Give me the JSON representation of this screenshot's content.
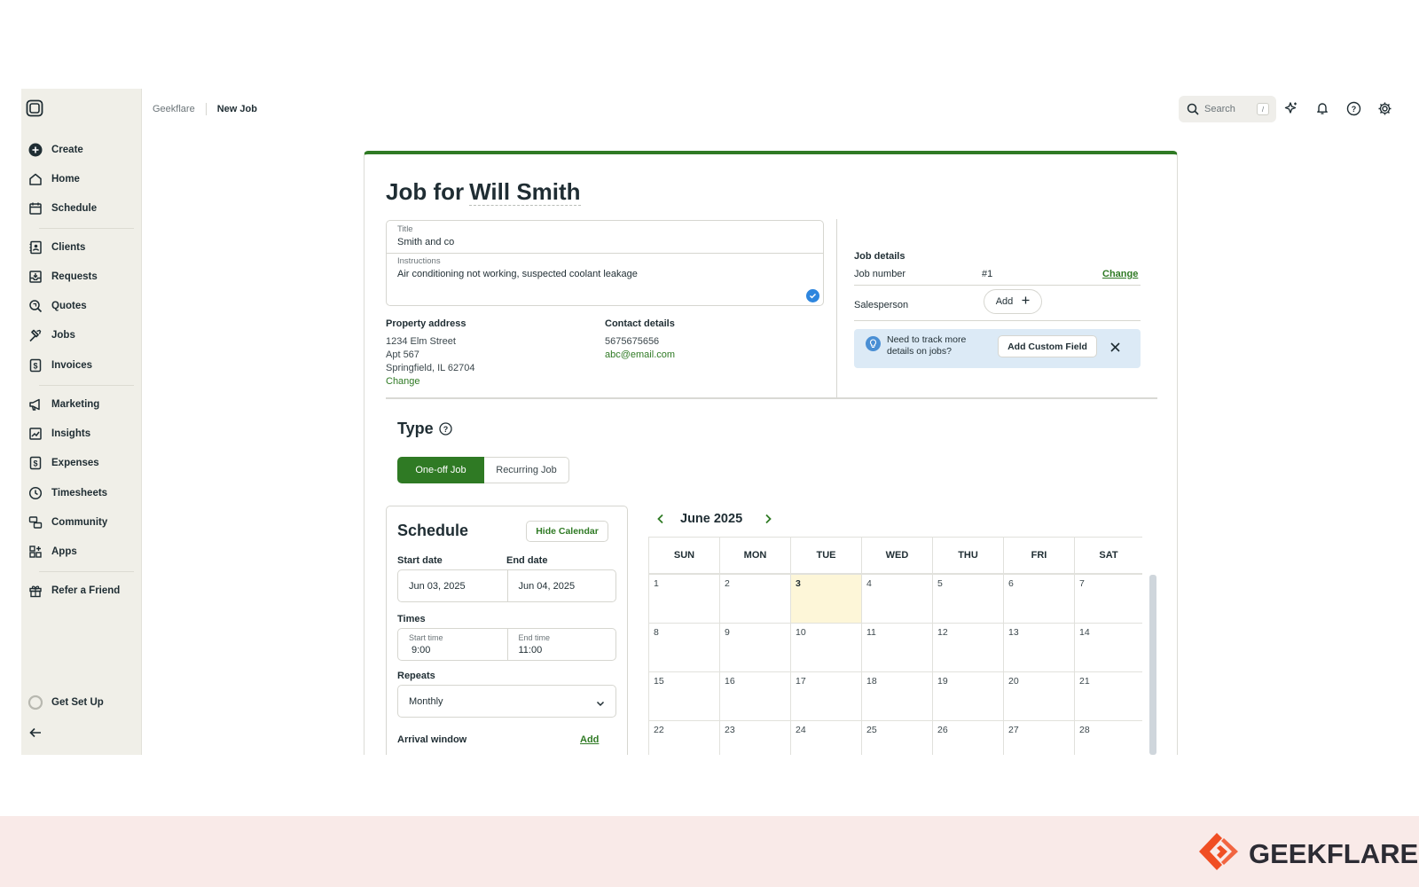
{
  "sidebar": {
    "items": [
      {
        "label": "Create",
        "icon": "plus-circle-icon"
      },
      {
        "label": "Home",
        "icon": "home-icon"
      },
      {
        "label": "Schedule",
        "icon": "calendar-icon"
      },
      {
        "label": "Clients",
        "icon": "contacts-icon"
      },
      {
        "label": "Requests",
        "icon": "inbox-icon"
      },
      {
        "label": "Quotes",
        "icon": "quote-search-icon"
      },
      {
        "label": "Jobs",
        "icon": "hammer-icon"
      },
      {
        "label": "Invoices",
        "icon": "invoice-dollar-icon"
      },
      {
        "label": "Marketing",
        "icon": "megaphone-icon"
      },
      {
        "label": "Insights",
        "icon": "chart-icon"
      },
      {
        "label": "Expenses",
        "icon": "expense-dollar-icon"
      },
      {
        "label": "Timesheets",
        "icon": "clock-icon"
      },
      {
        "label": "Community",
        "icon": "community-icon"
      },
      {
        "label": "Apps",
        "icon": "apps-icon"
      },
      {
        "label": "Refer a Friend",
        "icon": "gift-icon"
      },
      {
        "label": "Get Set Up",
        "icon": "progress-ring-icon"
      }
    ]
  },
  "header": {
    "breadcrumb_root": "Geekflare",
    "breadcrumb_current": "New Job",
    "search_placeholder": "Search",
    "search_shortcut": "/"
  },
  "job": {
    "heading_prefix": "Job for",
    "client_name": "Will Smith",
    "title_label": "Title",
    "title_value": "Smith and co",
    "instructions_label": "Instructions",
    "instructions_value": "Air conditioning not working, suspected coolant leakage",
    "property_label": "Property address",
    "address_lines": [
      "1234 Elm Street",
      "Apt 567",
      "Springfield, IL 62704"
    ],
    "address_change": "Change",
    "contact_label": "Contact details",
    "phone": "5675675656",
    "email": "abc@email.com"
  },
  "details": {
    "title": "Job details",
    "job_number_label": "Job number",
    "job_number_value": "#1",
    "change_label": "Change",
    "salesperson_label": "Salesperson",
    "add_label": "Add",
    "banner_text": "Need to track more details on jobs?",
    "custom_field_button": "Add Custom Field"
  },
  "type": {
    "title": "Type",
    "one_off": "One-off Job",
    "recurring": "Recurring Job"
  },
  "schedule": {
    "title": "Schedule",
    "hide_calendar": "Hide Calendar",
    "start_date_label": "Start date",
    "start_date": "Jun 03, 2025",
    "end_date_label": "End date",
    "end_date": "Jun 04, 2025",
    "times_label": "Times",
    "start_time_label": "Start time",
    "start_time": "9:00",
    "end_time_label": "End time",
    "end_time": "11:00",
    "repeats_label": "Repeats",
    "repeats_value": "Monthly",
    "arrival_label": "Arrival window",
    "arrival_add": "Add"
  },
  "calendar": {
    "month": "June 2025",
    "weekdays": [
      "SUN",
      "MON",
      "TUE",
      "WED",
      "THU",
      "FRI",
      "SAT"
    ],
    "weeks": [
      [
        "1",
        "2",
        "3",
        "4",
        "5",
        "6",
        "7"
      ],
      [
        "8",
        "9",
        "10",
        "11",
        "12",
        "13",
        "14"
      ],
      [
        "15",
        "16",
        "17",
        "18",
        "19",
        "20",
        "21"
      ],
      [
        "22",
        "23",
        "24",
        "25",
        "26",
        "27",
        "28"
      ]
    ],
    "highlighted_day": "3"
  },
  "brand": {
    "name": "GEEKFLARE",
    "accent_color": "#f04e23"
  },
  "colors": {
    "primary_green": "#2f7a24",
    "sidebar_bg": "#f0efe8",
    "banner_bg": "#dceaf6",
    "today_bg": "#fdf6d8"
  }
}
